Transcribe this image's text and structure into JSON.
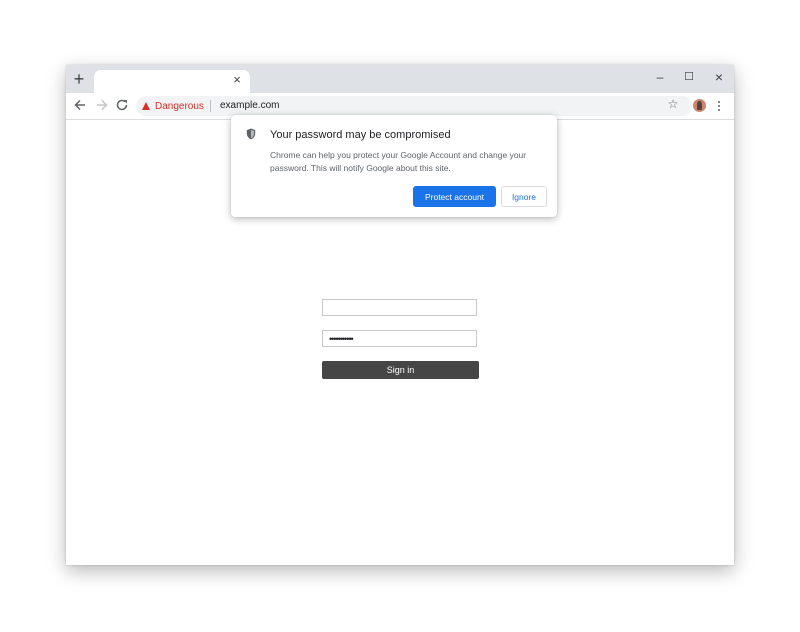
{
  "browser": {
    "tab": {
      "close_glyph": "×"
    },
    "new_tab_glyph": "+",
    "window_controls": {
      "minimize": "–",
      "maximize": "☐",
      "close": "×"
    },
    "nav": {
      "back_icon": "arrow-back-icon",
      "forward_icon": "arrow-forward-icon",
      "reload_icon": "reload-icon"
    },
    "security_label": "Dangerous",
    "url": "example.com",
    "colors": {
      "danger": "#d93025",
      "accent": "#1a73e8",
      "tabstrip": "#dee1e6"
    }
  },
  "bubble": {
    "title": "Your password may be compromised",
    "body": "Chrome can help you protect your Google Account and change your password. This will notify Google about this site.",
    "primary_label": "Protect account",
    "secondary_label": "Ignore"
  },
  "page": {
    "username_value": "",
    "password_value": "•••••••••••",
    "signin_label": "Sign in"
  }
}
